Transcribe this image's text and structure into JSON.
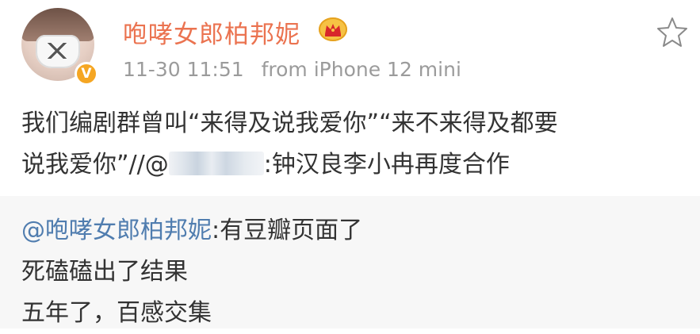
{
  "post": {
    "username": "咆哮女郎柏邦妮",
    "verified_badge": "V",
    "timestamp": "11-30 11:51",
    "source": "from iPhone 12 mini",
    "content_part1": "我们编剧群曾叫“来得及说我爱你”“来不来得及都要",
    "content_part2": "说我爱你”//@",
    "content_part3": ":钟汉良李小冉再度合作",
    "icons": {
      "crown": "crown-icon",
      "favorite": "star-outline-icon"
    }
  },
  "retweet": {
    "mention": "@咆哮女郎柏邦妮",
    "line1_rest": ":有豆瓣页面了",
    "line2": "死磕磕出了结果",
    "line3": "五年了，百感交集"
  },
  "colors": {
    "username": "#eb7350",
    "link": "#507daf",
    "meta": "#9b9b9b",
    "retweet_bg": "#f7f7f7",
    "badge": "#f5a623"
  }
}
